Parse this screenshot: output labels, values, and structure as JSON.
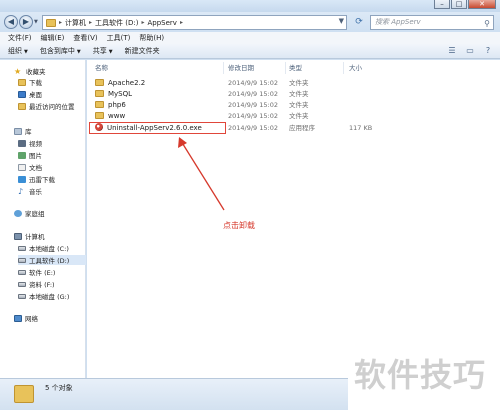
{
  "window": {
    "controls": {
      "minimize": "–",
      "maximize": "□",
      "close": "✕"
    }
  },
  "address": {
    "crumbs": [
      "计算机",
      "工具软件 (D:)",
      "AppServ"
    ],
    "separator": "▸",
    "search_placeholder": "搜索 AppServ"
  },
  "menubar": {
    "items": [
      "文件(F)",
      "编辑(E)",
      "查看(V)",
      "工具(T)",
      "帮助(H)"
    ]
  },
  "toolbar": {
    "organize": "组织",
    "include_in_library": "包含到库中",
    "share": "共享",
    "new_folder": "新建文件夹"
  },
  "sidebar": {
    "favorites": {
      "title": "收藏夹",
      "items": [
        "下载",
        "桌面",
        "最近访问的位置"
      ]
    },
    "libraries": {
      "title": "库",
      "items": [
        "视频",
        "图片",
        "文档",
        "迅雷下载",
        "音乐"
      ]
    },
    "homegroup": "家庭组",
    "computer": {
      "title": "计算机",
      "drives": [
        "本地磁盘 (C:)",
        "工具软件 (D:)",
        "软件 (E:)",
        "资料 (F:)",
        "本地磁盘 (G:)"
      ]
    },
    "network": "网络"
  },
  "filelist": {
    "columns": {
      "name": "名称",
      "date": "修改日期",
      "type": "类型",
      "size": "大小"
    },
    "rows": [
      {
        "name": "Apache2.2",
        "date": "2014/9/9 15:02",
        "type": "文件夹",
        "size": ""
      },
      {
        "name": "MySQL",
        "date": "2014/9/9 15:02",
        "type": "文件夹",
        "size": ""
      },
      {
        "name": "php6",
        "date": "2014/9/9 15:02",
        "type": "文件夹",
        "size": ""
      },
      {
        "name": "www",
        "date": "2014/9/9 15:02",
        "type": "文件夹",
        "size": ""
      },
      {
        "name": "Uninstall-AppServ2.6.0.exe",
        "date": "2014/9/9 15:02",
        "type": "应用程序",
        "size": "117 KB"
      }
    ]
  },
  "annotation": "点击卸载",
  "status": {
    "count": "5 个对象"
  },
  "watermark": "软件技巧",
  "colors": {
    "annotation": "#d6392c",
    "folder": "#e8c25a"
  }
}
